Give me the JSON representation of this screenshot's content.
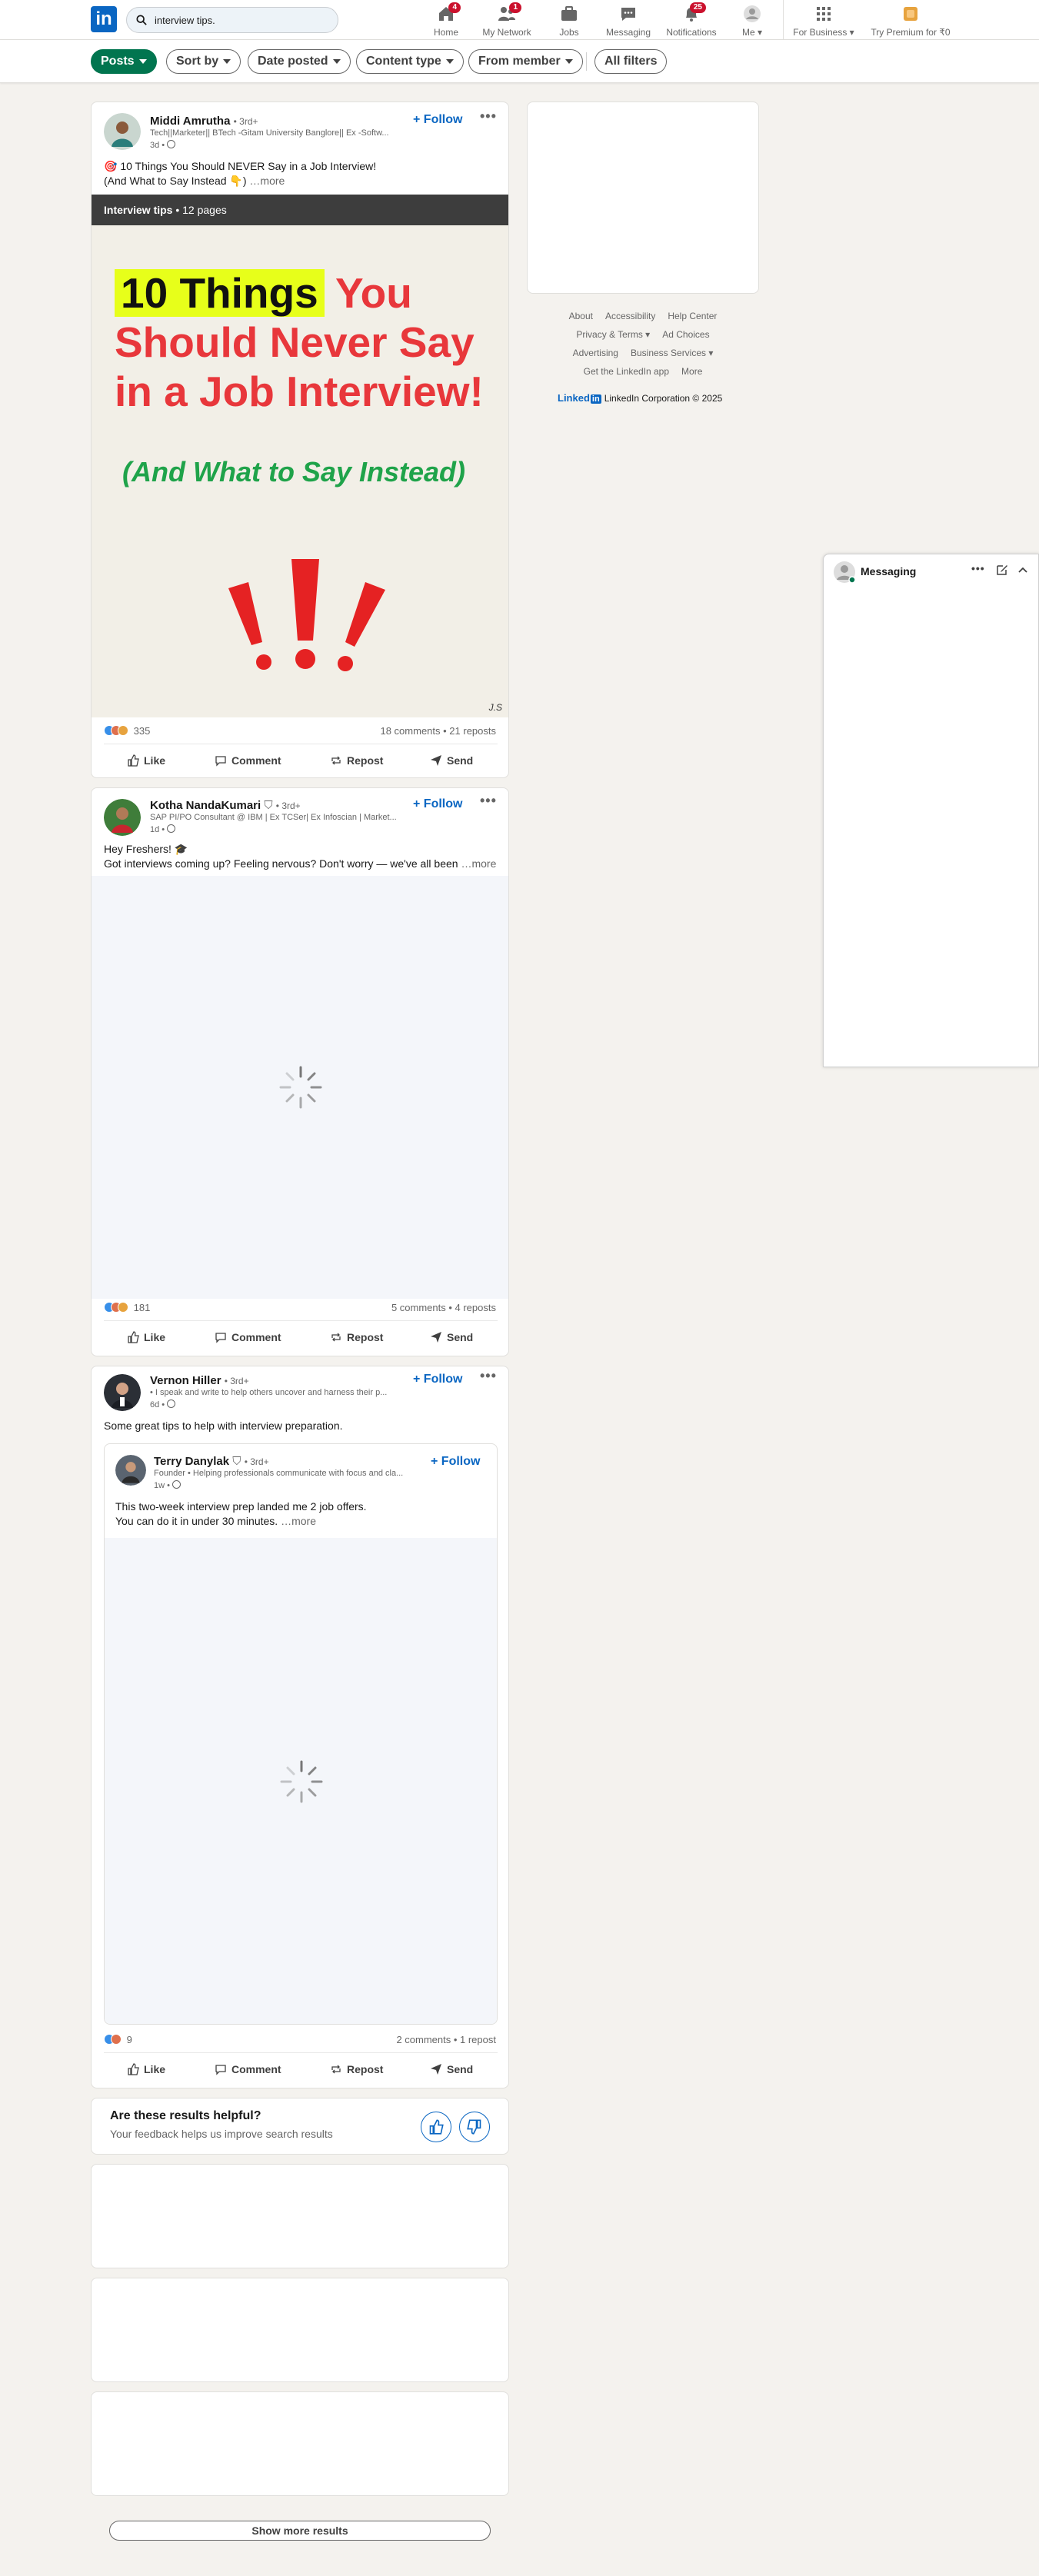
{
  "header": {
    "search_value": "interview tips.",
    "nav": [
      {
        "label": "Home",
        "badge": "4"
      },
      {
        "label": "My Network",
        "badge": "1"
      },
      {
        "label": "Jobs",
        "badge": ""
      },
      {
        "label": "Messaging",
        "badge": ""
      },
      {
        "label": "Notifications",
        "badge": "25"
      },
      {
        "label": "Me",
        "badge": ""
      },
      {
        "label": "For Business",
        "badge": ""
      },
      {
        "label": "Try Premium for ₹0",
        "badge": ""
      }
    ]
  },
  "filters": [
    "Posts",
    "Sort by",
    "Date posted",
    "Content type",
    "From member",
    "All filters"
  ],
  "posts": [
    {
      "author": "Middi Amrutha",
      "degree": "• 3rd+",
      "headline": "Tech||Marketer|| BTech -Gitam University Banglore|| Ex -Softw...",
      "time": "3d •",
      "follow": "+ Follow",
      "text_line1": "🎯 10 Things You Should NEVER Say in a Job Interview!",
      "text_line2": "(And What to Say Instead 👇)",
      "more": "…more",
      "doc_title": "Interview tips",
      "doc_pages": " • 12 pages",
      "doc_highlight": "10 Things",
      "doc_line1_rest": " You",
      "doc_line2": "Should Never Say",
      "doc_line3": "in a Job Interview!",
      "doc_sub": "(And What to Say Instead)",
      "doc_sig": "J.S",
      "reactions": "335",
      "comments_reposts": "18 comments • 21 reposts"
    },
    {
      "author": "Kotha NandaKumari",
      "degree": "• 3rd+",
      "headline": "SAP PI/PO Consultant @ IBM | Ex TCSer| Ex Infoscian | Market...",
      "time": "1d •",
      "follow": "+ Follow",
      "text_line1": "Hey Freshers! 🎓",
      "text_line2": "Got interviews coming up? Feeling nervous? Don't worry — we've all been",
      "more": "…more",
      "reactions": "181",
      "comments_reposts": "5 comments • 4 reposts"
    },
    {
      "author": "Vernon Hiller",
      "degree": "• 3rd+",
      "headline": "• I speak and write to help others uncover and harness their p...",
      "time": "6d •",
      "follow": "+ Follow",
      "text_line1": "Some great tips to help with interview preparation.",
      "embed": {
        "author": "Terry Danylak",
        "degree": "• 3rd+",
        "headline": "Founder • Helping professionals communicate with focus and cla...",
        "time": "1w •",
        "follow": "+ Follow",
        "text_line1": "This two-week interview prep landed me 2 job offers.",
        "text_line2": "You can do it in under 30 minutes.",
        "more": "…more"
      },
      "reactions": "9",
      "comments_reposts": "2 comments • 1 repost"
    }
  ],
  "actions": [
    "Like",
    "Comment",
    "Repost",
    "Send"
  ],
  "feedback": {
    "title": "Are these results helpful?",
    "subtitle": "Your feedback helps us improve search results"
  },
  "show_more": "Show more results",
  "footer": {
    "row1": [
      "About",
      "Accessibility",
      "Help Center"
    ],
    "row2": [
      "Privacy & Terms ▾",
      "Ad Choices"
    ],
    "row3": [
      "Advertising",
      "Business Services ▾"
    ],
    "row4": [
      "Get the LinkedIn app",
      "More"
    ],
    "logo_text": "Linked",
    "logo_in": "in",
    "copyright": "LinkedIn Corporation © 2025"
  },
  "messaging": {
    "title": "Messaging"
  },
  "colors": {
    "brand": "#0a66c2",
    "active_filter": "#01754f",
    "doc_red": "#e8373b",
    "doc_green": "#1fa34a",
    "highlight": "#e7ff1a"
  }
}
